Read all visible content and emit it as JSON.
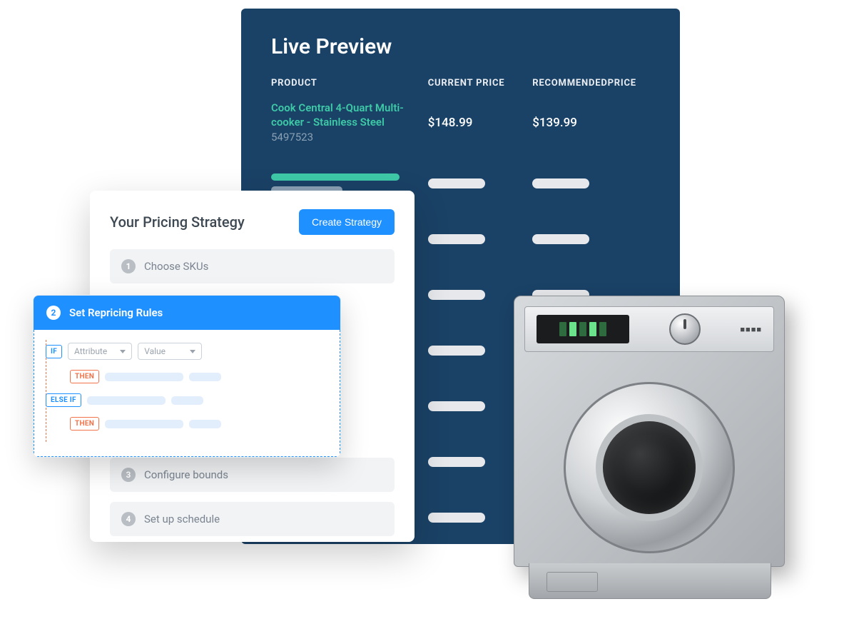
{
  "livePreview": {
    "title": "Live Preview",
    "headers": {
      "product": "PRODUCT",
      "current": "CURRENT PRICE",
      "recommended": "RECOMMENDEDPRICE"
    },
    "row": {
      "name": "Cook Central 4-Quart Multi-cooker - Stainless Steel",
      "sku": "5497523",
      "currentPrice": "$148.99",
      "recommendedPrice": "$139.99"
    }
  },
  "strategy": {
    "title": "Your Pricing Strategy",
    "createButton": "Create Strategy",
    "steps": {
      "s1": "Choose SKUs",
      "s3": "Configure bounds",
      "s4": "Set up schedule"
    }
  },
  "rules": {
    "title": "Set Repricing Rules",
    "stepNumber": "2",
    "tags": {
      "if": "IF",
      "then": "THEN",
      "elseif": "ELSE IF"
    },
    "selects": {
      "attribute": "Attribute",
      "value": "Value"
    }
  },
  "stepNumbers": {
    "n1": "1",
    "n3": "3",
    "n4": "4"
  }
}
